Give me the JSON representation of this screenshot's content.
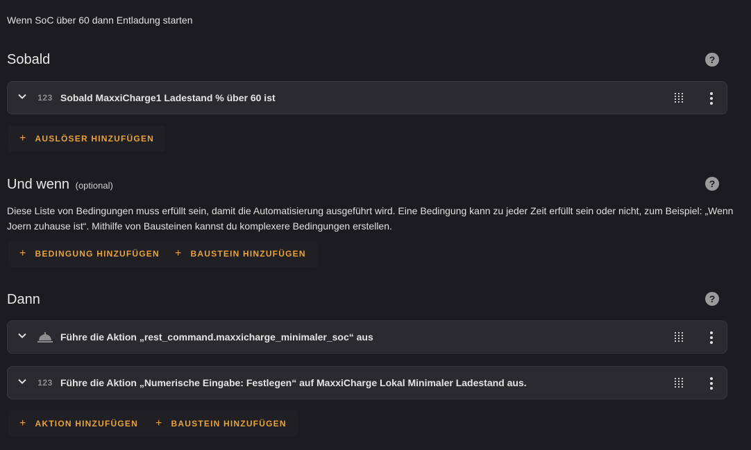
{
  "description": "Wenn SoC über 60 dann Entladung starten",
  "sections": {
    "triggers": {
      "title": "Sobald",
      "help_icon": "question-circle-icon",
      "cards": [
        {
          "icon": "numeric-123-icon",
          "icon_text": "123",
          "label": "Sobald MaxxiCharge1 Ladestand % über 60 ist"
        }
      ],
      "add_button": "AUSLÖSER HINZUFÜGEN"
    },
    "conditions": {
      "title": "Und wenn",
      "optional_label": "(optional)",
      "help_icon": "question-circle-icon",
      "description": "Diese Liste von Bedingungen muss erfüllt sein, damit die Automatisierung ausgeführt wird. Eine Bedingung kann zu jeder Zeit erfüllt sein oder nicht, zum Beispiel: „Wenn Joern zuhause ist“. Mithilfe von Bausteinen kannst du komplexere Bedingungen erstellen.",
      "add_button": "BEDINGUNG HINZUFÜGEN",
      "building_block_button": "BAUSTEIN HINZUFÜGEN"
    },
    "actions": {
      "title": "Dann",
      "help_icon": "question-circle-icon",
      "cards": [
        {
          "icon": "room-service-bell-icon",
          "icon_text": "",
          "label": "Führe die Aktion „rest_command.maxxicharge_minimaler_soc“ aus"
        },
        {
          "icon": "numeric-123-icon",
          "icon_text": "123",
          "label": "Führe die Aktion „Numerische Eingabe: Festlegen“ auf MaxxiCharge Lokal Minimaler Ladestand aus."
        }
      ],
      "add_button": "AKTION HINZUFÜGEN",
      "building_block_button": "BAUSTEIN HINZUFÜGEN"
    }
  },
  "colors": {
    "background": "#1c1b1f",
    "card": "#2b2a2f",
    "accent": "#e8a33a",
    "icon_grey": "#8e8e8e"
  }
}
